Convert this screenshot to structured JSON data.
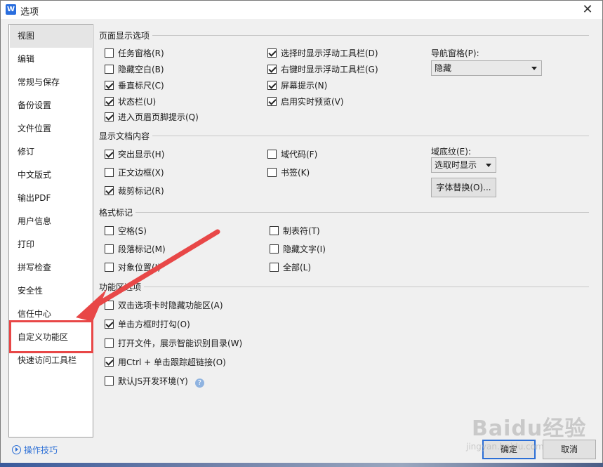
{
  "window": {
    "title": "选项",
    "app_icon_letter": "W"
  },
  "sidebar": {
    "items": [
      {
        "label": "视图",
        "selected": true
      },
      {
        "label": "编辑"
      },
      {
        "label": "常规与保存"
      },
      {
        "label": "备份设置"
      },
      {
        "label": "文件位置"
      },
      {
        "label": "修订"
      },
      {
        "label": "中文版式"
      },
      {
        "label": "输出PDF"
      },
      {
        "label": "用户信息"
      },
      {
        "label": "打印"
      },
      {
        "label": "拼写检查"
      },
      {
        "label": "安全性"
      },
      {
        "label": "信任中心"
      },
      {
        "label": "自定义功能区",
        "highlighted": true
      },
      {
        "label": "快速访问工具栏"
      }
    ]
  },
  "sections": {
    "page_display": {
      "title": "页面显示选项",
      "options": [
        {
          "label": "任务窗格(R)",
          "checked": false
        },
        {
          "label": "隐藏空白(B)",
          "checked": false
        },
        {
          "label": "垂直标尺(C)",
          "checked": true
        },
        {
          "label": "状态栏(U)",
          "checked": true
        },
        {
          "label": "进入页眉页脚提示(Q)",
          "checked": true
        },
        {
          "label": "选择时显示浮动工具栏(D)",
          "checked": true
        },
        {
          "label": "右键时显示浮动工具栏(G)",
          "checked": true
        },
        {
          "label": "屏幕提示(N)",
          "checked": true
        },
        {
          "label": "启用实时预览(V)",
          "checked": true
        }
      ],
      "nav_pane_label": "导航窗格(P):",
      "nav_pane_value": "隐藏"
    },
    "doc_content": {
      "title": "显示文档内容",
      "options": [
        {
          "label": "突出显示(H)",
          "checked": true
        },
        {
          "label": "正文边框(X)",
          "checked": false
        },
        {
          "label": "裁剪标记(R)",
          "checked": true
        },
        {
          "label": "域代码(F)",
          "checked": false
        },
        {
          "label": "书签(K)",
          "checked": false
        }
      ],
      "field_shading_label": "域底纹(E):",
      "field_shading_value": "选取时显示",
      "font_replace_button": "字体替换(O)..."
    },
    "format_marks": {
      "title": "格式标记",
      "options": [
        {
          "label": "空格(S)",
          "checked": false
        },
        {
          "label": "段落标记(M)",
          "checked": false
        },
        {
          "label": "对象位置(J)",
          "checked": false
        },
        {
          "label": "制表符(T)",
          "checked": false
        },
        {
          "label": "隐藏文字(I)",
          "checked": false
        },
        {
          "label": "全部(L)",
          "checked": false
        }
      ]
    },
    "ribbon": {
      "title": "功能区选项",
      "options": [
        {
          "label": "双击选项卡时隐藏功能区(A)",
          "checked": false
        },
        {
          "label": "单击方框时打勾(O)",
          "checked": true
        },
        {
          "label": "打开文件，展示智能识别目录(W)",
          "checked": false
        },
        {
          "label": "用Ctrl + 单击跟踪超链接(O)",
          "checked": true
        },
        {
          "label": "默认JS开发环境(Y)",
          "checked": false
        }
      ],
      "help_icon": "question-icon"
    }
  },
  "footer": {
    "tips_label": "操作技巧",
    "ok_label": "确定",
    "cancel_label": "取消"
  },
  "watermark": {
    "brand": "Baidu经验",
    "sub": "jingyan.baidu.com"
  },
  "colors": {
    "accent": "#2c6fd6",
    "annotation": "#e84747"
  }
}
